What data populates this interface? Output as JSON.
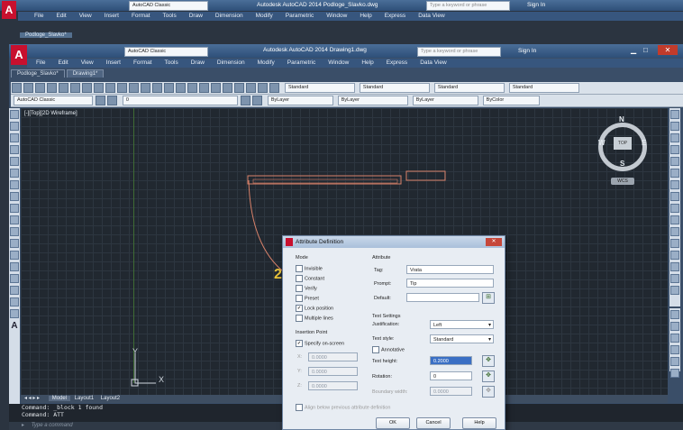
{
  "back_window": {
    "title": "Autodesk AutoCAD 2014   Podloge_Slavko.dwg",
    "workspace": "AutoCAD Classic",
    "search_placeholder": "Type a keyword or phrase",
    "sign_in": "Sign In",
    "menus": [
      "File",
      "Edit",
      "View",
      "Insert",
      "Format",
      "Tools",
      "Draw",
      "Dimension",
      "Modify",
      "Parametric",
      "Window",
      "Help",
      "Express",
      "Data View"
    ],
    "tab": "Podloge_Slavko*"
  },
  "front_window": {
    "title": "Autodesk AutoCAD 2014   Drawing1.dwg",
    "workspace": "AutoCAD Classic",
    "search_placeholder": "Type a keyword or phrase",
    "sign_in": "Sign In",
    "menus": [
      "File",
      "Edit",
      "View",
      "Insert",
      "Format",
      "Tools",
      "Draw",
      "Dimension",
      "Modify",
      "Parametric",
      "Window",
      "Help",
      "Express",
      "Data View"
    ],
    "tabs": [
      "Podloge_Slavko*",
      "Drawing1*"
    ],
    "toolbar_combos": {
      "text_style": "Standard",
      "dim_style": "Standard",
      "table_style": "Standard",
      "mleader_style": "Standard"
    },
    "props": {
      "workspace": "AutoCAD Classic",
      "layer": "0",
      "color": "ByLayer",
      "linetype": "ByLayer",
      "lineweight": "ByLayer",
      "plotstyle": "ByColor"
    }
  },
  "viewport": {
    "label": "[-][Top][2D Wireframe]",
    "viewcube": {
      "n": "N",
      "s": "S",
      "e": "E",
      "w": "W",
      "top": "TOP",
      "wcs": "WCS"
    },
    "ucs_x": "X",
    "ucs_y": "Y",
    "canvas_glyph": "2"
  },
  "layout_tabs": [
    "Model",
    "Layout1",
    "Layout2"
  ],
  "command": {
    "history": [
      "Command: _block 1 found",
      "Command: ATT"
    ],
    "placeholder": "Type a command"
  },
  "dialog": {
    "title": "Attribute Definition",
    "mode": {
      "label": "Mode",
      "items": [
        {
          "label": "Invisible",
          "checked": false
        },
        {
          "label": "Constant",
          "checked": false
        },
        {
          "label": "Verify",
          "checked": false
        },
        {
          "label": "Preset",
          "checked": false
        },
        {
          "label": "Lock position",
          "checked": true
        },
        {
          "label": "Multiple lines",
          "checked": false
        }
      ]
    },
    "attribute": {
      "label": "Attribute",
      "tag_label": "Tag:",
      "tag": "Vrata",
      "prompt_label": "Prompt:",
      "prompt": "Tip",
      "default_label": "Default:",
      "default": ""
    },
    "insertion": {
      "label": "Insertion Point",
      "specify_label": "Specify on-screen",
      "specify_checked": true,
      "x_label": "X:",
      "x": "0.0000",
      "y_label": "Y:",
      "y": "0.0000",
      "z_label": "Z:",
      "z": "0.0000"
    },
    "text_settings": {
      "label": "Text Settings",
      "justification_label": "Justification:",
      "justification": "Left",
      "style_label": "Text style:",
      "style": "Standard",
      "annotative_label": "Annotative",
      "annotative": false,
      "height_label": "Text height:",
      "height": "0.2000",
      "rotation_label": "Rotation:",
      "rotation": "0",
      "boundary_label": "Boundary width:",
      "boundary": "0.0000"
    },
    "align_label": "Align below previous attribute definition",
    "buttons": {
      "ok": "OK",
      "cancel": "Cancel",
      "help": "Help"
    }
  },
  "colors": {
    "accent_red": "#c8102e",
    "canvas": "#212830",
    "drawing_line": "#d9826a",
    "ucs_green": "#5a9a3a"
  }
}
